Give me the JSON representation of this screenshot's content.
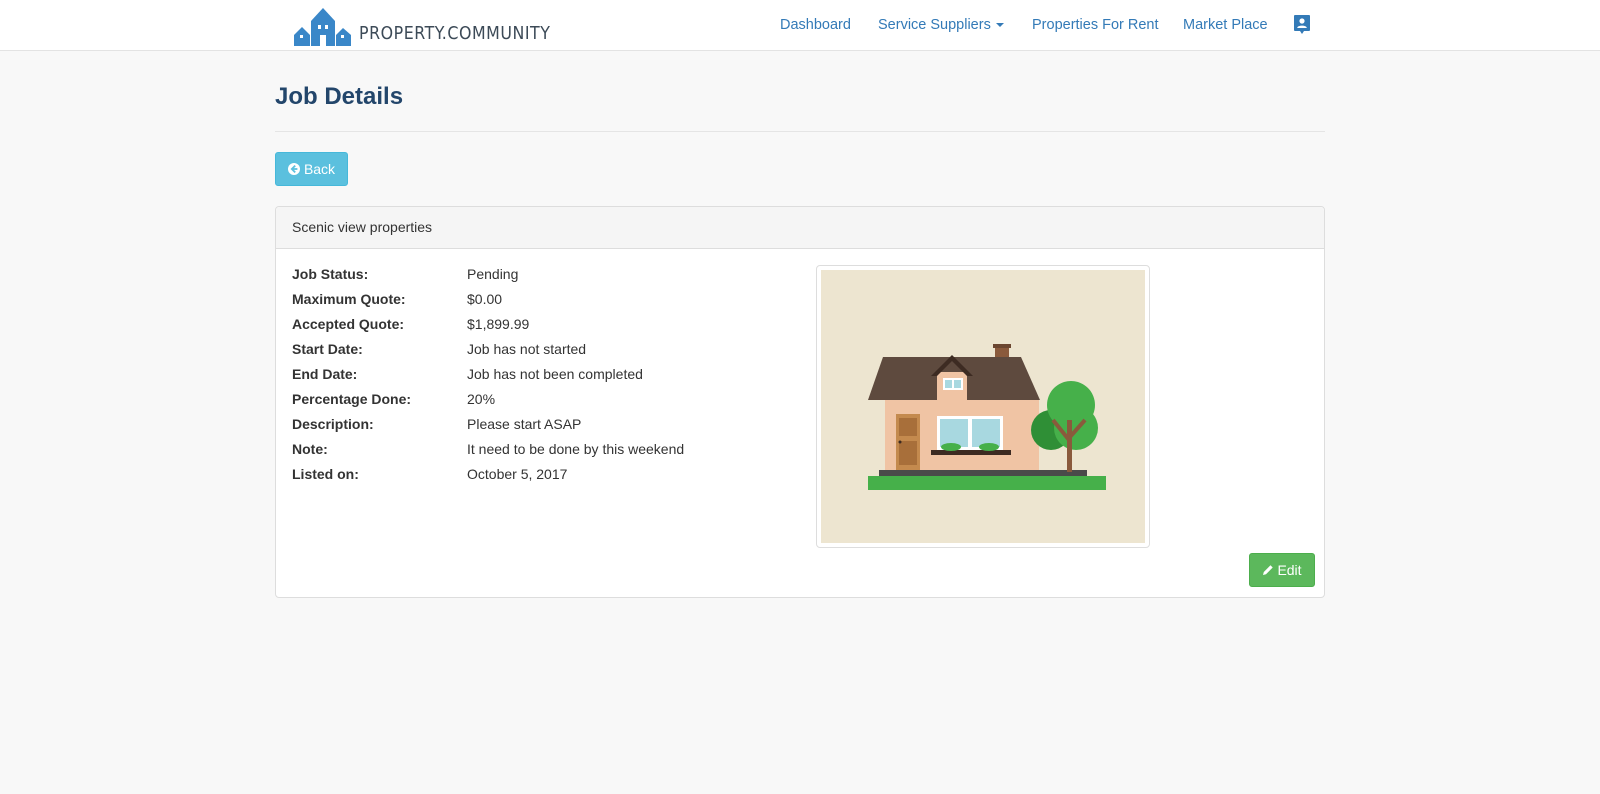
{
  "brand": {
    "name": "PROPERTY.COMMUNITY"
  },
  "nav": {
    "dashboard": "Dashboard",
    "service_suppliers": "Service Suppliers",
    "properties_for_rent": "Properties For Rent",
    "market_place": "Market Place"
  },
  "page": {
    "title": "Job Details"
  },
  "buttons": {
    "back": "Back",
    "edit": "Edit"
  },
  "job": {
    "property_name": "Scenic view properties",
    "fields": [
      {
        "label": "Job Status:",
        "value": "Pending"
      },
      {
        "label": "Maximum Quote:",
        "value": "$0.00"
      },
      {
        "label": "Accepted Quote:",
        "value": "$1,899.99"
      },
      {
        "label": "Start Date:",
        "value": "Job has not started"
      },
      {
        "label": "End Date:",
        "value": "Job has not been completed"
      },
      {
        "label": "Percentage Done:",
        "value": "20%"
      },
      {
        "label": "Description:",
        "value": "Please start ASAP"
      },
      {
        "label": "Note:",
        "value": "It need to be done by this weekend"
      },
      {
        "label": "Listed on:",
        "value": "October 5, 2017"
      }
    ]
  },
  "colors": {
    "brand_blue": "#3a87c8",
    "link": "#337ab7",
    "title": "#23466b",
    "info_button": "#5bc0de",
    "success_button": "#5cb85c"
  },
  "icons": {
    "logo": "house-logo-icon",
    "profile": "user-profile-icon",
    "back": "arrow-left-icon",
    "edit": "pencil-icon"
  }
}
